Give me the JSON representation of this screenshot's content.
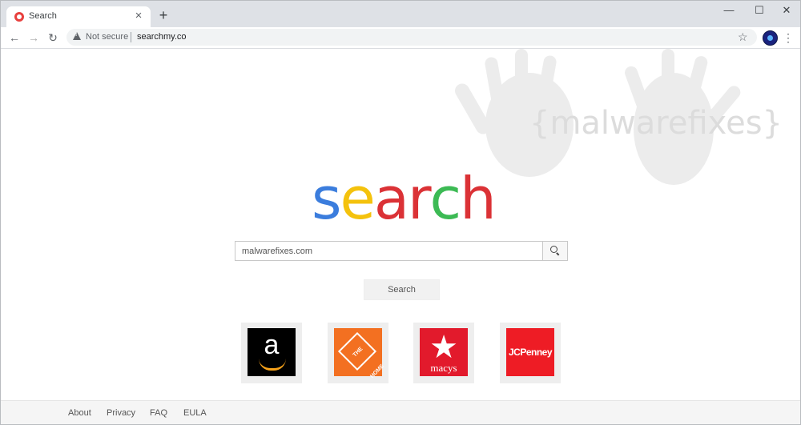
{
  "browser": {
    "tab_title": "Search",
    "new_tab": "+",
    "close_tab": "×",
    "window": {
      "minimize": "—",
      "maximize": "☐",
      "close": "✕"
    },
    "nav": {
      "back": "←",
      "forward": "→",
      "reload": "↻"
    },
    "security_label": "Not secure",
    "url": "searchmy.co",
    "bookmark_icon": "☆",
    "menu_icon": "⋮"
  },
  "watermark": "{malwarefixes}",
  "logo": {
    "letters": [
      {
        "char": "s",
        "color": "#3b7ddd"
      },
      {
        "char": "e",
        "color": "#f4c20d"
      },
      {
        "char": "a",
        "color": "#db3236"
      },
      {
        "char": "r",
        "color": "#db3236"
      },
      {
        "char": "c",
        "color": "#3cba54"
      },
      {
        "char": "h",
        "color": "#db3236"
      }
    ]
  },
  "search": {
    "value": "malwarefixes.com",
    "button_label": "Search"
  },
  "shortcuts": [
    {
      "name": "Amazon",
      "logo_text": "a"
    },
    {
      "name": "The Home Depot",
      "logo_text": "THE HOME DEPOT"
    },
    {
      "name": "Macy's",
      "logo_text": "macys"
    },
    {
      "name": "JCPenney",
      "logo_text": "JCPenney"
    }
  ],
  "footer": {
    "links": [
      "About",
      "Privacy",
      "FAQ",
      "EULA"
    ]
  }
}
